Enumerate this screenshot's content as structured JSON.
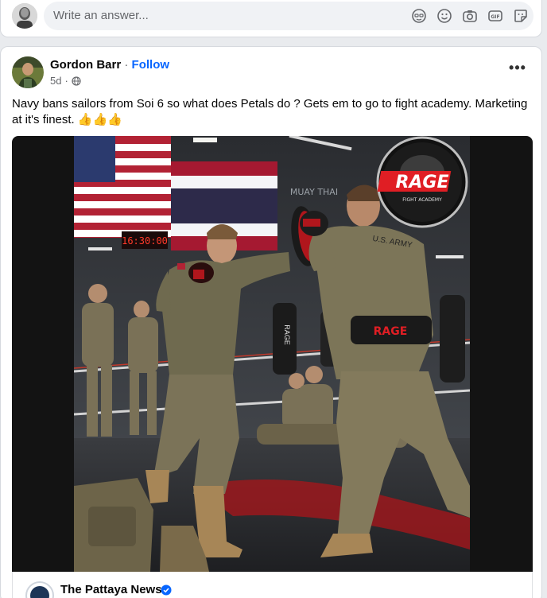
{
  "comment_box": {
    "placeholder": "Write an answer...",
    "icons": [
      "avatar-icon",
      "emoji-icon",
      "camera-icon",
      "gif-icon",
      "sticker-icon"
    ]
  },
  "post": {
    "author": "Gordon Barr",
    "separator": " · ",
    "follow_label": "Follow",
    "time": "5d",
    "meta_separator": "·",
    "privacy_icon": "globe-icon",
    "more_label": "•••",
    "text": "Navy bans sailors from Soi 6 so what does Petals do ? Gets em to go to fight academy. Marketing at it's finest. 👍👍👍",
    "image": {
      "clock": "16:30:00",
      "logo_main": "RAGE",
      "logo_sub": "FIGHT ACADEMY",
      "banner": "MUAY THAI",
      "bag_label": "RAGE",
      "belt_label": "RAGE",
      "shirt_label": "U.S. ARMY"
    },
    "link_preview": {
      "source": "The Pattaya News",
      "verified_icon": "verified-badge-icon"
    }
  },
  "colors": {
    "link_blue": "#0866ff",
    "muted": "#65676b",
    "brand_red": "#e01e24"
  }
}
